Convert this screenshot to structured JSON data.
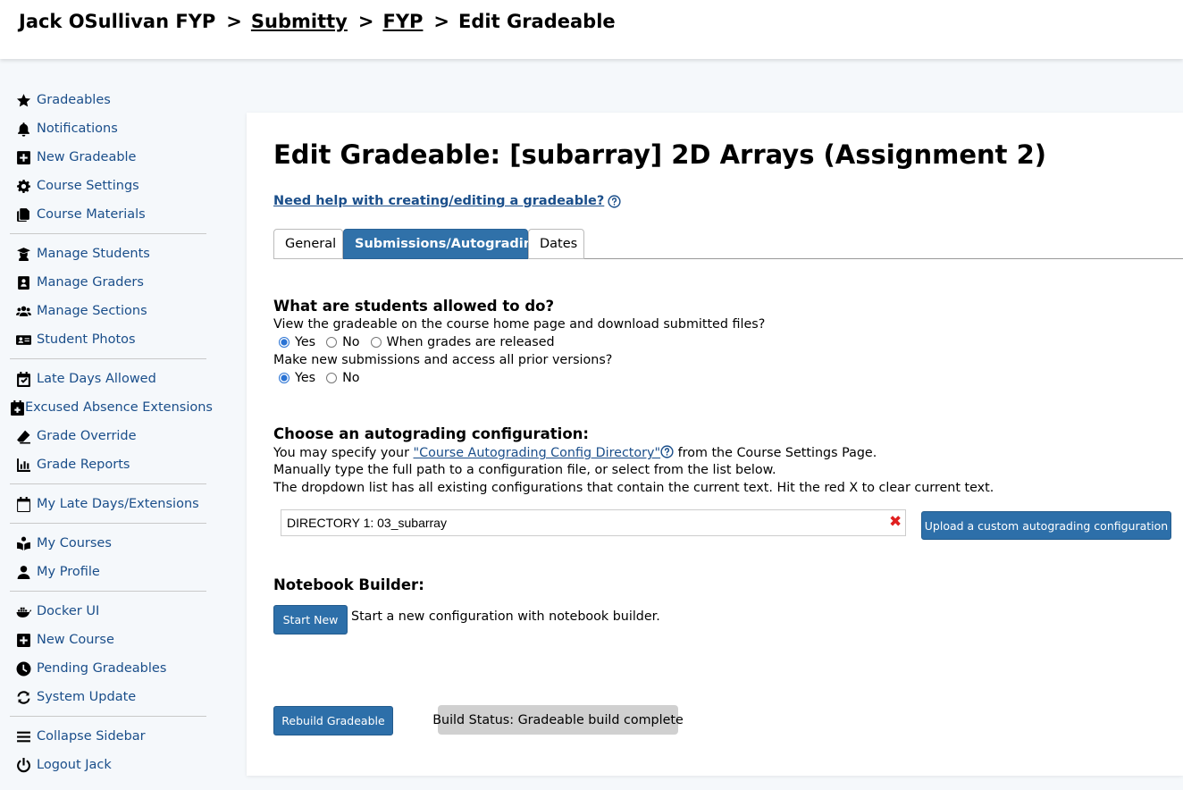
{
  "breadcrumb": {
    "root": "Jack OSullivan FYP",
    "sep": ">",
    "items": [
      "Submitty",
      "FYP"
    ],
    "current": "Edit Gradeable"
  },
  "sidebar": {
    "groups": [
      [
        {
          "label": "Gradeables",
          "icon": "star-icon"
        },
        {
          "label": "Notifications",
          "icon": "bell-icon"
        },
        {
          "label": "New Gradeable",
          "icon": "plus-square-icon"
        },
        {
          "label": "Course Settings",
          "icon": "gear-icon"
        },
        {
          "label": "Course Materials",
          "icon": "copy-icon"
        }
      ],
      [
        {
          "label": "Manage Students",
          "icon": "user-graduate-icon"
        },
        {
          "label": "Manage Graders",
          "icon": "address-book-icon"
        },
        {
          "label": "Manage Sections",
          "icon": "users-icon"
        },
        {
          "label": "Student Photos",
          "icon": "id-card-icon"
        }
      ],
      [
        {
          "label": "Late Days Allowed",
          "icon": "calendar-check-icon"
        },
        {
          "label": "Excused Absence Extensions",
          "icon": "calendar-plus-icon"
        },
        {
          "label": "Grade Override",
          "icon": "eraser-icon"
        },
        {
          "label": "Grade Reports",
          "icon": "chart-bar-icon"
        }
      ],
      [
        {
          "label": "My Late Days/Extensions",
          "icon": "calendar-icon"
        }
      ],
      [
        {
          "label": "My Courses",
          "icon": "book-reader-icon"
        },
        {
          "label": "My Profile",
          "icon": "user-icon"
        }
      ],
      [
        {
          "label": "Docker UI",
          "icon": "docker-icon"
        },
        {
          "label": "New Course",
          "icon": "plus-square-icon"
        },
        {
          "label": "Pending Gradeables",
          "icon": "clock-icon"
        },
        {
          "label": "System Update",
          "icon": "sync-icon"
        }
      ],
      [
        {
          "label": "Collapse Sidebar",
          "icon": "bars-icon"
        },
        {
          "label": "Logout Jack",
          "icon": "power-icon"
        }
      ]
    ]
  },
  "main": {
    "title": "Edit Gradeable: [subarray] 2D Arrays (Assignment 2)",
    "help_link": "Need help with creating/editing a gradeable?",
    "tabs": [
      "General",
      "Submissions/Autograding",
      "Dates"
    ],
    "active_tab": "Submissions/Autograding",
    "students_section": {
      "title": "What are students allowed to do?",
      "q1": "View the gradeable on the course home page and download submitted files?",
      "q1_options": [
        "Yes",
        "No",
        "When grades are released"
      ],
      "q1_selected": "Yes",
      "q2": "Make new submissions and access all prior versions?",
      "q2_options": [
        "Yes",
        "No"
      ],
      "q2_selected": "Yes"
    },
    "autograding": {
      "title": "Choose an autograding configuration:",
      "line1_prefix": "You may specify your ",
      "line1_link": "\"Course Autograding Config Directory\"",
      "line1_suffix": " from the Course Settings Page.",
      "line2": "Manually type the full path to a configuration file, or select from the list below.",
      "line3": "The dropdown list has all existing configurations that contain the current text. Hit the red X to clear current text.",
      "config_value": "DIRECTORY 1: 03_subarray",
      "clear_symbol": "✖",
      "upload_button": "Upload a custom autograding configuration"
    },
    "notebook": {
      "title": "Notebook Builder:",
      "start_button": "Start New",
      "description": "Start a new configuration with notebook builder."
    },
    "rebuild_button": "Rebuild Gradeable",
    "build_status": "Build Status: Gradeable build complete"
  },
  "colors": {
    "accent": "#2d6fa9",
    "link": "#1a4e8a",
    "clear": "#e02020",
    "status_bg": "#d0d0d0"
  }
}
